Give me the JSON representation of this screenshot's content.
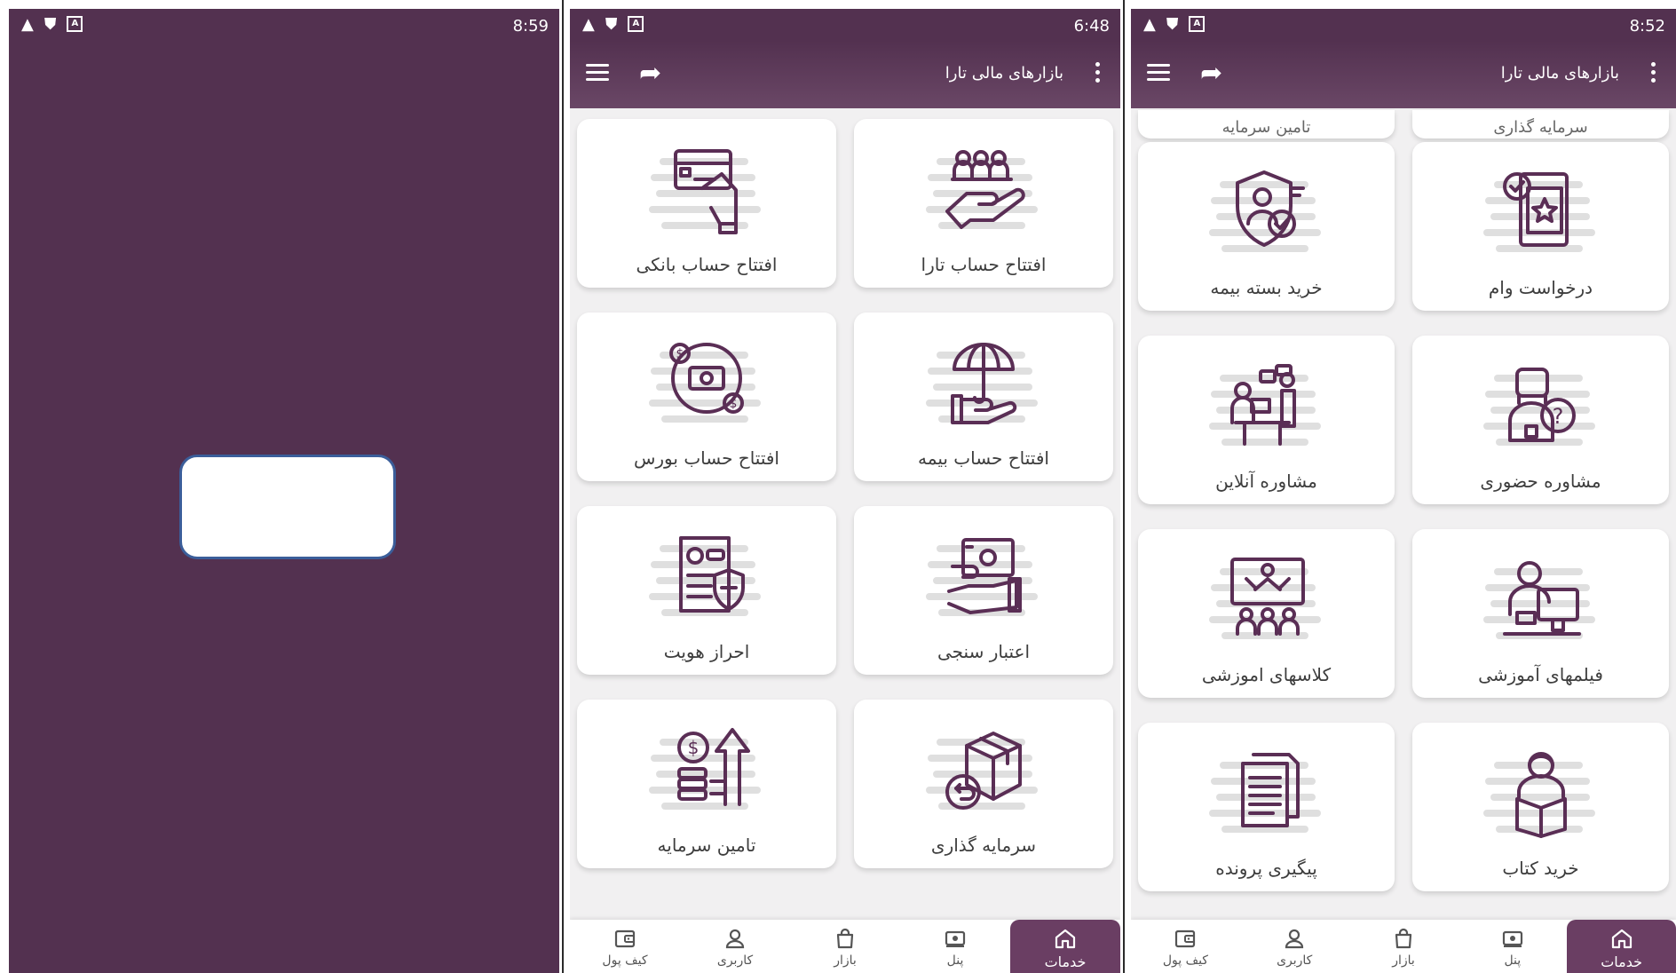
{
  "screen1": {
    "status": {
      "time": "8:59"
    }
  },
  "screen2": {
    "status": {
      "time": "6:48"
    },
    "app_title": "بازارهای مالی تارا",
    "cards": [
      {
        "label": "افتتاح حساب بانکی",
        "icon": "bank-card-icon"
      },
      {
        "label": "افتتاح حساب تارا",
        "icon": "hand-people-icon"
      },
      {
        "label": "افتتاح حساب بورس",
        "icon": "exchange-money-icon"
      },
      {
        "label": "افتتاح حساب بیمه",
        "icon": "umbrella-hand-icon"
      },
      {
        "label": "احراز هویت",
        "icon": "id-shield-icon"
      },
      {
        "label": "اعتبار سنجی",
        "icon": "cash-hand-icon"
      },
      {
        "label": "تامین سرمایه",
        "icon": "coins-arrow-icon"
      },
      {
        "label": "سرمایه گذاری",
        "icon": "box-return-icon"
      }
    ],
    "nav": [
      {
        "label": "خدمات",
        "icon": "home-icon",
        "active": true
      },
      {
        "label": "پنل",
        "icon": "panel-icon",
        "active": false
      },
      {
        "label": "بازار",
        "icon": "bag-icon",
        "active": false
      },
      {
        "label": "کاربری",
        "icon": "user-icon",
        "active": false
      },
      {
        "label": "کیف پول",
        "icon": "wallet-icon",
        "active": false
      }
    ]
  },
  "screen3": {
    "status": {
      "time": "8:52"
    },
    "app_title": "بازارهای مالی تارا",
    "partial_cards": [
      {
        "label": "تامین سرمایه"
      },
      {
        "label": "سرمایه گذاری"
      }
    ],
    "cards": [
      {
        "label": "خرید بسته بیمه",
        "icon": "shield-person-icon"
      },
      {
        "label": "درخواست وام",
        "icon": "loan-document-icon"
      },
      {
        "label": "مشاوره آنلاین",
        "icon": "online-consult-icon"
      },
      {
        "label": "مشاوره حضوری",
        "icon": "person-question-icon"
      },
      {
        "label": "کلاسهای اموزشی",
        "icon": "classroom-icon"
      },
      {
        "label": "فیلمهای آموزشی",
        "icon": "video-lesson-icon"
      },
      {
        "label": "پیگیری پرونده",
        "icon": "documents-icon"
      },
      {
        "label": "خرید کتاب",
        "icon": "person-book-icon"
      }
    ],
    "nav": [
      {
        "label": "خدمات",
        "icon": "home-icon",
        "active": true
      },
      {
        "label": "پنل",
        "icon": "panel-icon",
        "active": false
      },
      {
        "label": "بازار",
        "icon": "bag-icon",
        "active": false
      },
      {
        "label": "کاربری",
        "icon": "user-icon",
        "active": false
      },
      {
        "label": "کیف پول",
        "icon": "wallet-icon",
        "active": false
      }
    ]
  },
  "colors": {
    "brand": "#533150",
    "accent": "#6a3e63",
    "icon_stroke": "#5a2e55",
    "icon_shadow": "#dcdcdc"
  }
}
